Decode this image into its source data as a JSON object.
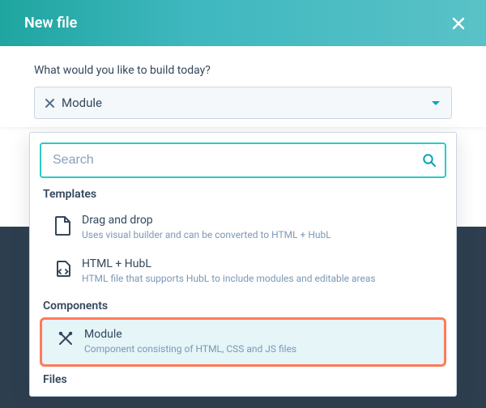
{
  "header": {
    "title": "New file"
  },
  "body": {
    "prompt": "What would you like to build today?"
  },
  "select": {
    "value": "Module"
  },
  "search": {
    "placeholder": "Search"
  },
  "groups": {
    "templates": {
      "title": "Templates",
      "items": [
        {
          "label": "Drag and drop",
          "desc": "Uses visual builder and can be converted to HTML + HubL"
        },
        {
          "label": "HTML + HubL",
          "desc": "HTML file that supports HubL to include modules and editable areas"
        }
      ]
    },
    "components": {
      "title": "Components",
      "items": [
        {
          "label": "Module",
          "desc": "Component consisting of HTML, CSS and JS files"
        }
      ]
    },
    "files": {
      "title": "Files"
    }
  }
}
